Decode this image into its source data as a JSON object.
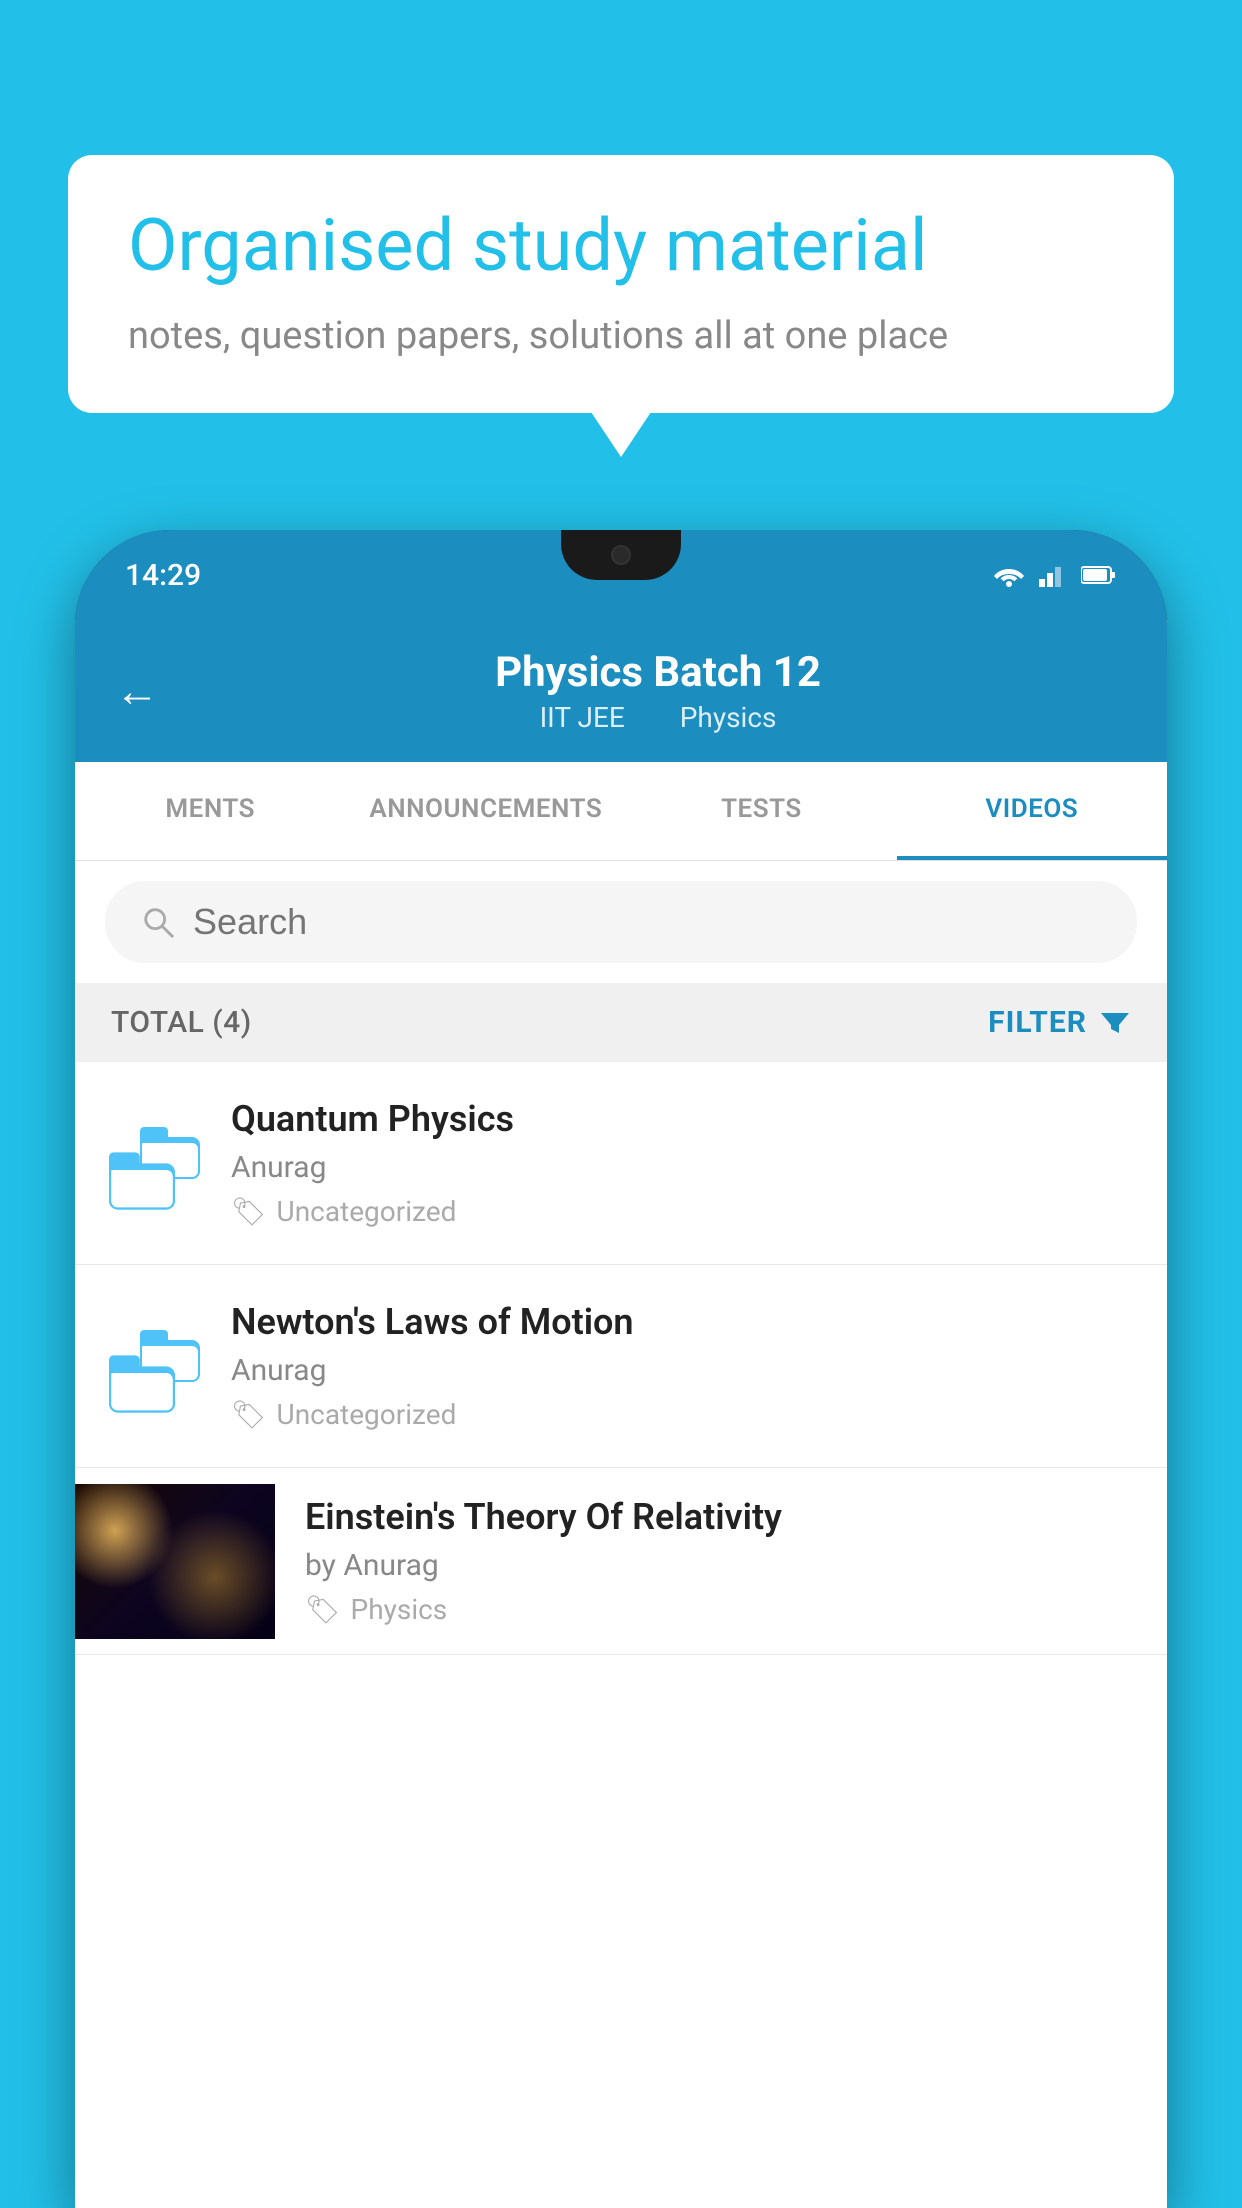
{
  "background": {
    "color": "#22c0e8"
  },
  "speech_bubble": {
    "title": "Organised study material",
    "subtitle": "notes, question papers, solutions all at one place"
  },
  "phone": {
    "status_bar": {
      "time": "14:29"
    },
    "app_header": {
      "title": "Physics Batch 12",
      "subtitle_part1": "IIT JEE",
      "subtitle_part2": "Physics",
      "back_label": "←"
    },
    "tabs": [
      {
        "label": "MENTS",
        "active": false
      },
      {
        "label": "ANNOUNCEMENTS",
        "active": false
      },
      {
        "label": "TESTS",
        "active": false
      },
      {
        "label": "VIDEOS",
        "active": true
      }
    ],
    "search": {
      "placeholder": "Search"
    },
    "filter": {
      "total_label": "TOTAL (4)",
      "filter_label": "FILTER"
    },
    "videos": [
      {
        "title": "Quantum Physics",
        "author": "Anurag",
        "tag": "Uncategorized",
        "type": "folder"
      },
      {
        "title": "Newton's Laws of Motion",
        "author": "Anurag",
        "tag": "Uncategorized",
        "type": "folder"
      },
      {
        "title": "Einstein's Theory Of Relativity",
        "author": "by Anurag",
        "tag": "Physics",
        "type": "video"
      }
    ]
  }
}
